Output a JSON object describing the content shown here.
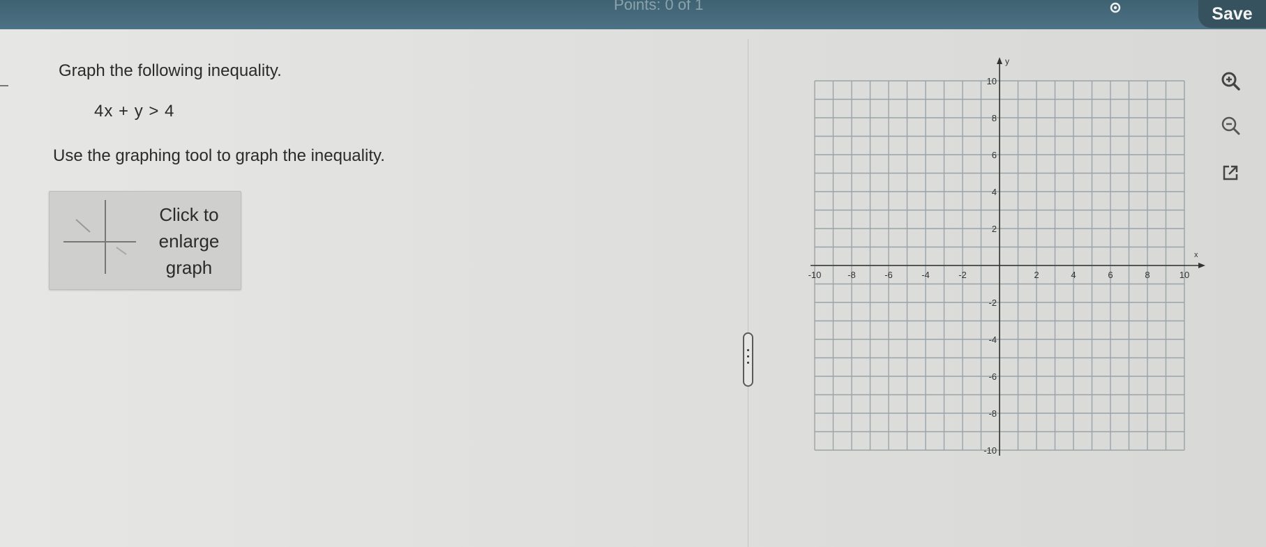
{
  "header": {
    "points_text": "Points: 0 of 1",
    "settings_icon": "gear-icon",
    "save_label": "Save"
  },
  "question": {
    "instruction": "Graph the following inequality.",
    "inequality": "4x + y > 4",
    "tool_instruction": "Use the graphing tool to graph the inequality."
  },
  "enlarge": {
    "line1": "Click to",
    "line2": "enlarge",
    "line3": "graph"
  },
  "graph": {
    "x_label": "x",
    "y_label": "y",
    "x_ticks": [
      "-10",
      "-8",
      "-6",
      "-4",
      "-2",
      "2",
      "4",
      "6",
      "8",
      "10"
    ],
    "y_ticks": [
      "10",
      "8",
      "6",
      "4",
      "2",
      "-2",
      "-4",
      "-6",
      "-8",
      "-10"
    ]
  },
  "tools": {
    "zoom_in_icon": "zoom-in-icon",
    "zoom_out_icon": "zoom-out-icon",
    "expand_icon": "expand-icon"
  },
  "colors": {
    "header_bar": "#456878",
    "save_button": "#36525f",
    "grid_line": "#9aa3a8",
    "axis": "#333333"
  }
}
